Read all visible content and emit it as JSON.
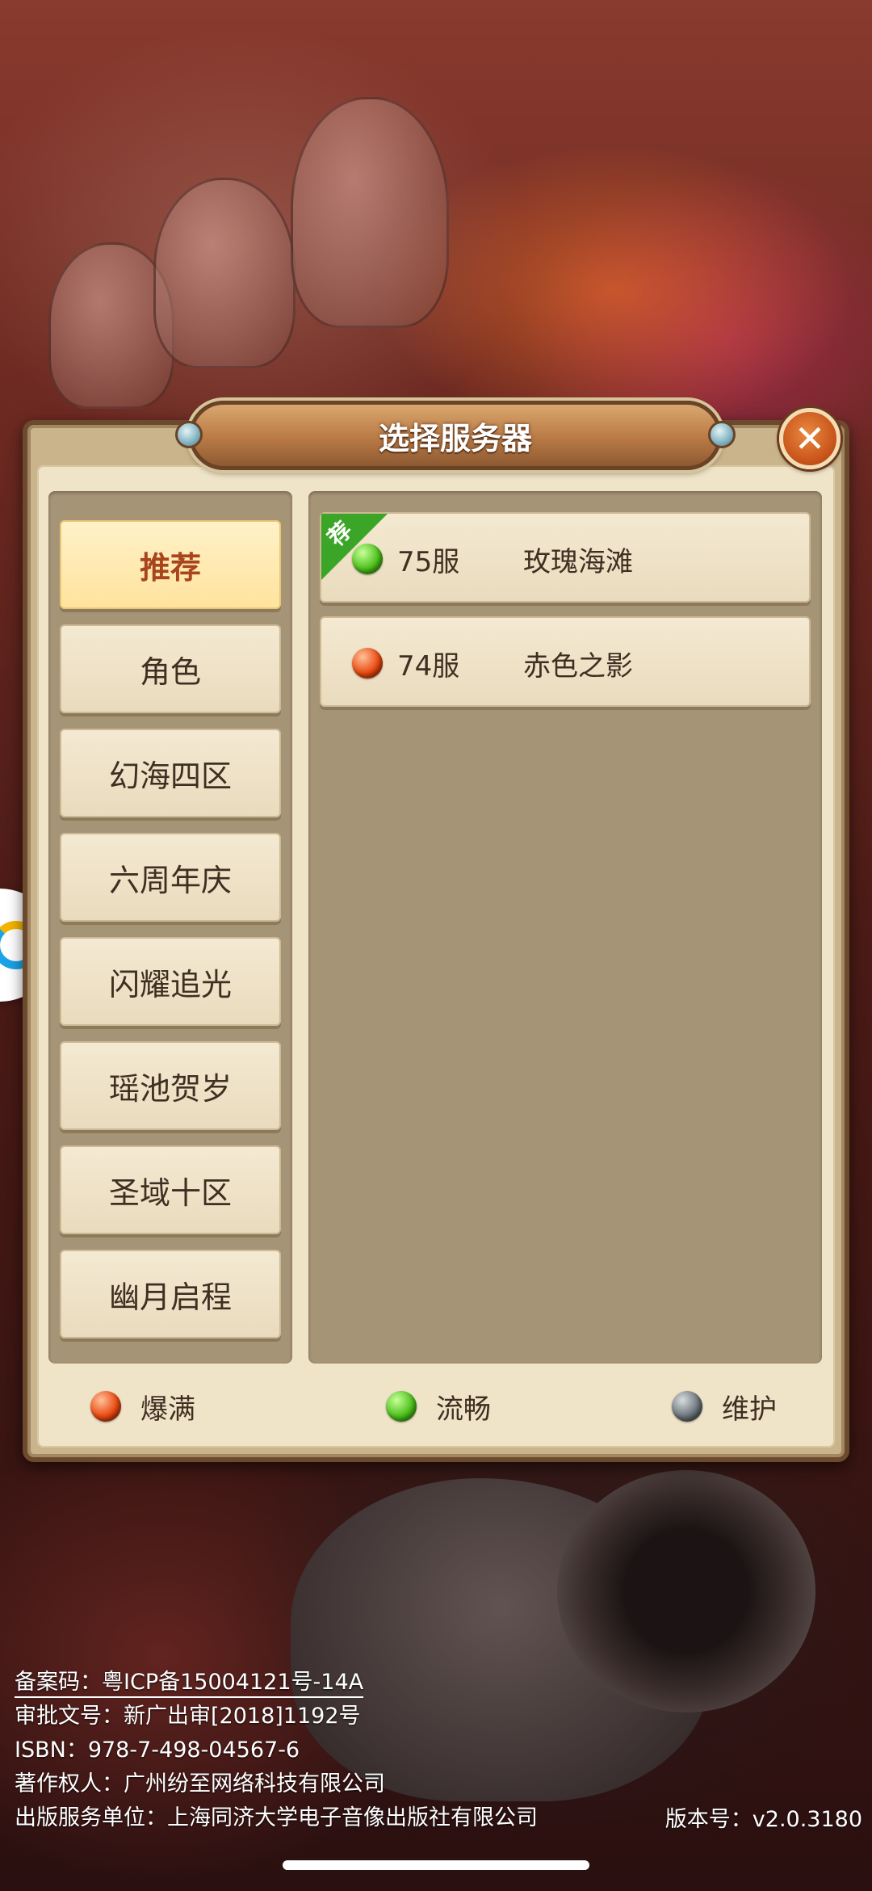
{
  "dialog": {
    "title": "选择服务器",
    "close_icon": "close-icon"
  },
  "tabs": [
    {
      "label": "推荐",
      "active": true
    },
    {
      "label": "角色",
      "active": false
    },
    {
      "label": "幻海四区",
      "active": false
    },
    {
      "label": "六周年庆",
      "active": false
    },
    {
      "label": "闪耀追光",
      "active": false
    },
    {
      "label": "瑶池贺岁",
      "active": false
    },
    {
      "label": "圣域十区",
      "active": false
    },
    {
      "label": "幽月启程",
      "active": false
    }
  ],
  "servers": [
    {
      "id": "75服",
      "name": "玫瑰海滩",
      "status": "green",
      "recommended_badge": "荐"
    },
    {
      "id": "74服",
      "name": "赤色之影",
      "status": "red"
    }
  ],
  "legend": [
    {
      "label": "爆满",
      "color": "red"
    },
    {
      "label": "流畅",
      "color": "green"
    },
    {
      "label": "维护",
      "color": "gray"
    }
  ],
  "footer": {
    "icp": "备案码：粤ICP备15004121号-14A",
    "approval": "审批文号：新广出审[2018]1192号",
    "isbn": "ISBN：978-7-498-04567-6",
    "copyright": "著作权人：广州纷至网络科技有限公司",
    "publisher": "出版服务单位：上海同济大学电子音像出版社有限公司",
    "version": "版本号：v2.0.3180"
  },
  "colors": {
    "status_full": "#ea4a12",
    "status_smooth": "#4cc01b",
    "status_maintenance": "#6c757b",
    "active_tab_text": "#a8451c"
  }
}
